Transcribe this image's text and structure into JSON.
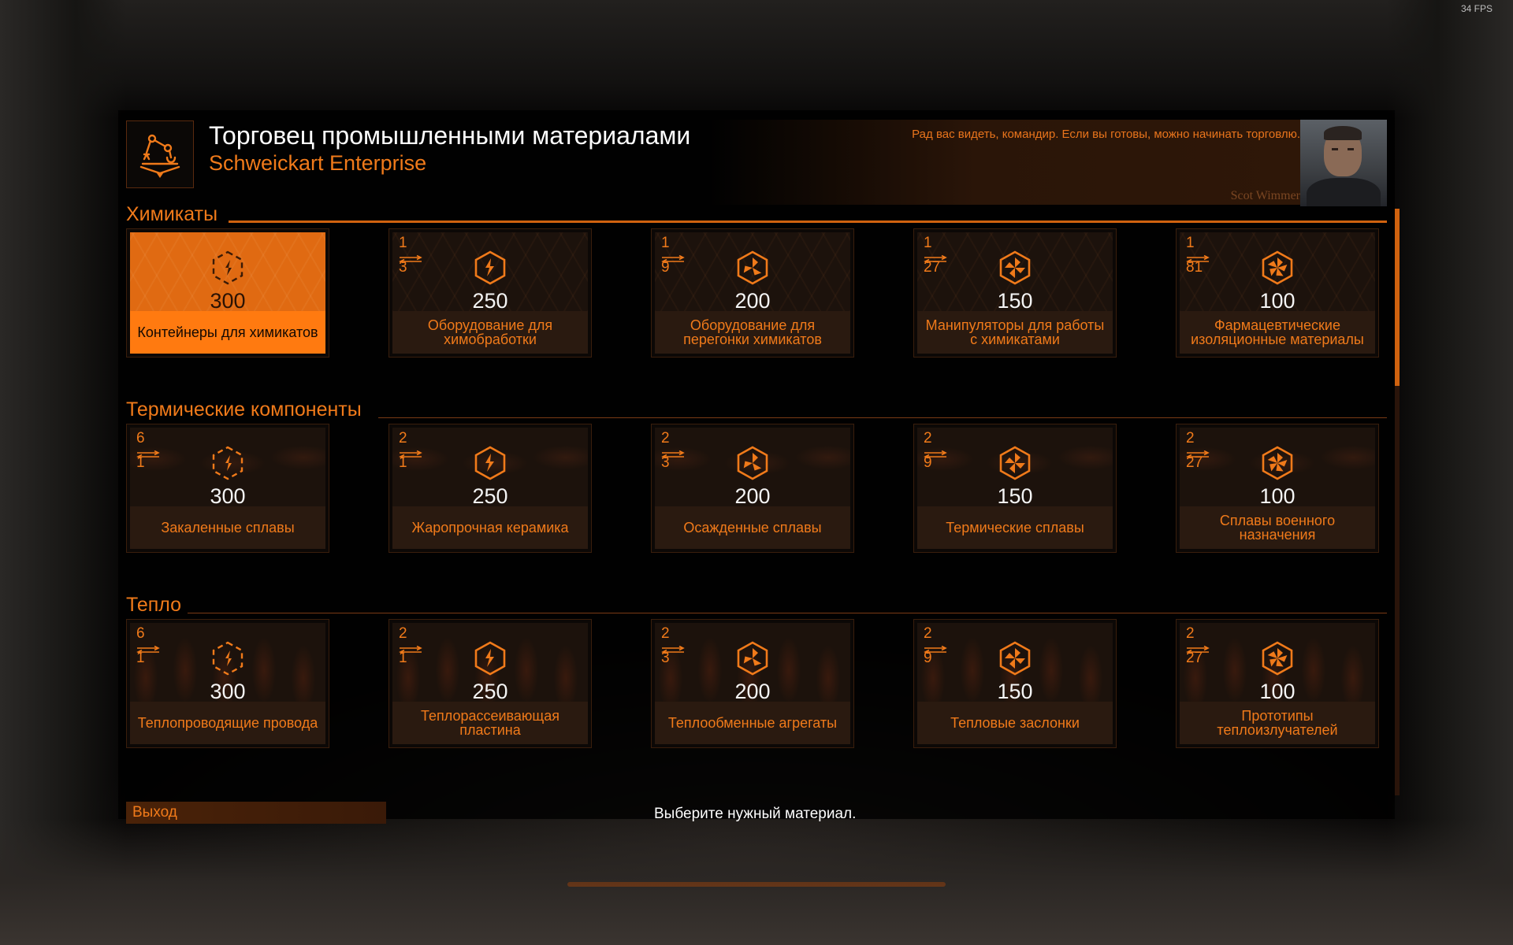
{
  "fps": "34 FPS",
  "header": {
    "title": "Торговец промышленными материалами",
    "subtitle": "Schweickart Enterprise",
    "greeting": "Рад вас видеть, командир. Если вы готовы, можно начинать торговлю.",
    "npc_name": "Scot Wimmer"
  },
  "sections": [
    {
      "title": "Химикаты",
      "items": [
        {
          "num": "",
          "den": "",
          "qty": "300",
          "name": "Контейнеры для химикатов",
          "selected": true,
          "grade": 1
        },
        {
          "num": "1",
          "den": "3",
          "qty": "250",
          "name": "Оборудование для химобработки",
          "selected": false,
          "grade": 2
        },
        {
          "num": "1",
          "den": "9",
          "qty": "200",
          "name": "Оборудование для перегонки химикатов",
          "selected": false,
          "grade": 3
        },
        {
          "num": "1",
          "den": "27",
          "qty": "150",
          "name": "Манипуляторы для работы с химикатами",
          "selected": false,
          "grade": 4
        },
        {
          "num": "1",
          "den": "81",
          "qty": "100",
          "name": "Фармацевтические изоляционные материалы",
          "selected": false,
          "grade": 5
        }
      ]
    },
    {
      "title": "Термические компоненты",
      "items": [
        {
          "num": "6",
          "den": "1",
          "qty": "300",
          "name": "Закаленные сплавы",
          "selected": false,
          "grade": 1
        },
        {
          "num": "2",
          "den": "1",
          "qty": "250",
          "name": "Жаропрочная керамика",
          "selected": false,
          "grade": 2
        },
        {
          "num": "2",
          "den": "3",
          "qty": "200",
          "name": "Осажденные сплавы",
          "selected": false,
          "grade": 3
        },
        {
          "num": "2",
          "den": "9",
          "qty": "150",
          "name": "Термические сплавы",
          "selected": false,
          "grade": 4
        },
        {
          "num": "2",
          "den": "27",
          "qty": "100",
          "name": "Сплавы военного назначения",
          "selected": false,
          "grade": 5
        }
      ]
    },
    {
      "title": "Тепло",
      "items": [
        {
          "num": "6",
          "den": "1",
          "qty": "300",
          "name": "Теплопроводящие провода",
          "selected": false,
          "grade": 1
        },
        {
          "num": "2",
          "den": "1",
          "qty": "250",
          "name": "Теплорассеивающая пластина",
          "selected": false,
          "grade": 2
        },
        {
          "num": "2",
          "den": "3",
          "qty": "200",
          "name": "Теплообменные агрегаты",
          "selected": false,
          "grade": 3
        },
        {
          "num": "2",
          "den": "9",
          "qty": "150",
          "name": "Тепловые заслонки",
          "selected": false,
          "grade": 4
        },
        {
          "num": "2",
          "den": "27",
          "qty": "100",
          "name": "Прототипы теплоизлучателей",
          "selected": false,
          "grade": 5
        }
      ]
    }
  ],
  "footer": {
    "exit_label": "Выход",
    "hint": "Выберите нужный материал."
  },
  "colors": {
    "accent": "#f07a1a",
    "selected": "#ff7a10",
    "card_bg": "#1c120c",
    "name_bar": "#2a1a10"
  },
  "icons": {
    "header": "material-trader-icon",
    "ratio": "exchange-arrows-icon",
    "grade": "material-grade-icon"
  }
}
